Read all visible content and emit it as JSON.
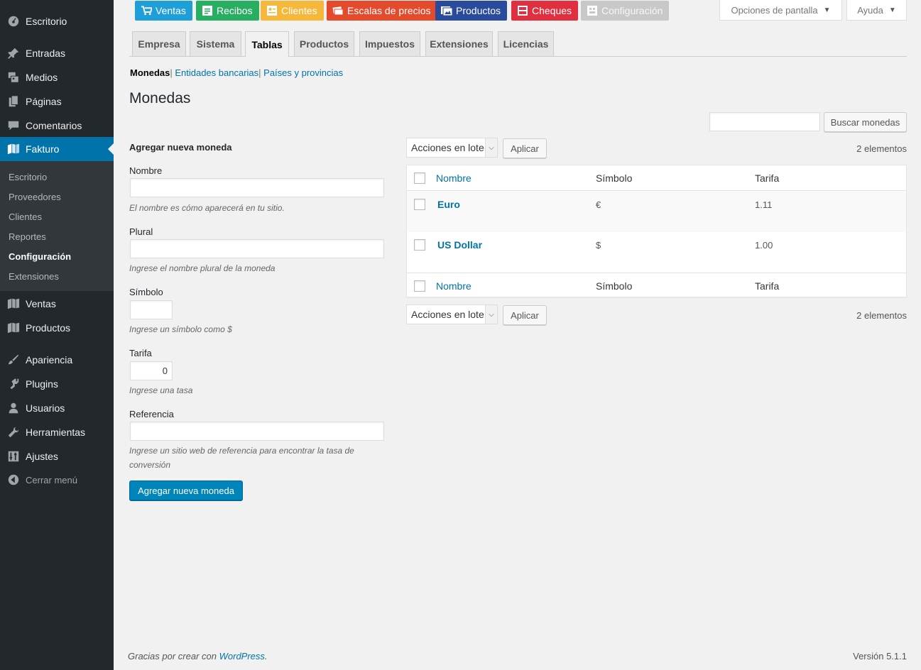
{
  "sidebar": {
    "menu": [
      {
        "label": "Escritorio",
        "icon": "dashboard-icon"
      },
      {
        "label": "Entradas",
        "icon": "pin-icon"
      },
      {
        "label": "Medios",
        "icon": "media-icon"
      },
      {
        "label": "Páginas",
        "icon": "pages-icon"
      },
      {
        "label": "Comentarios",
        "icon": "comments-icon"
      },
      {
        "label": "Fakturo",
        "icon": "fakturo-icon"
      }
    ],
    "submenu": [
      "Escritorio",
      "Proveedores",
      "Clientes",
      "Reportes",
      "Configuración",
      "Extensiones"
    ],
    "menu_after": [
      {
        "label": "Ventas",
        "icon": "fakturo-icon"
      },
      {
        "label": "Productos",
        "icon": "fakturo-icon"
      },
      {
        "label": "Apariencia",
        "icon": "brush-icon"
      },
      {
        "label": "Plugins",
        "icon": "plugin-icon"
      },
      {
        "label": "Usuarios",
        "icon": "user-icon"
      },
      {
        "label": "Herramientas",
        "icon": "wrench-icon"
      },
      {
        "label": "Ajustes",
        "icon": "settings-icon"
      }
    ],
    "collapse": "Cerrar menú"
  },
  "topbar": {
    "buttons": [
      {
        "label": "Ventas",
        "color": "#1e9fd8"
      },
      {
        "label": "Recibos",
        "color": "#27ae60"
      },
      {
        "label": "Clientes",
        "color": "#f6b83a"
      },
      {
        "label": "Escalas de precios",
        "color": "#e44b2c"
      },
      {
        "label": "Productos",
        "color": "#2a4a9c"
      },
      {
        "label": "Cheques",
        "color": "#e02f3f"
      },
      {
        "label": "Configuración",
        "color": "#c8c8c8"
      }
    ],
    "screen_options": "Opciones de pantalla",
    "help": "Ayuda"
  },
  "tabs": [
    "Empresa",
    "Sistema",
    "Tablas",
    "Productos",
    "Impuestos",
    "Extensiones",
    "Licencias"
  ],
  "active_tab": "Tablas",
  "sublinks": {
    "current": "Monedas",
    "links": [
      "Entidades bancarias",
      "Países y provincias"
    ]
  },
  "page_title": "Monedas",
  "search": {
    "button": "Buscar monedas",
    "value": ""
  },
  "form": {
    "title": "Agregar nueva moneda",
    "fields": [
      {
        "label": "Nombre",
        "value": "",
        "description": "El nombre es cómo aparecerá en tu sitio."
      },
      {
        "label": "Plural",
        "value": "",
        "description": "Ingrese el nombre plural de la moneda"
      },
      {
        "label": "Símbolo",
        "value": "",
        "description": "Ingrese un símbolo como $"
      },
      {
        "label": "Tarifa",
        "value": "0",
        "description": "Ingrese una tasa"
      },
      {
        "label": "Referencia",
        "value": "",
        "description": "Ingrese un sitio web de referencia para encontrar la tasa de conversión"
      }
    ],
    "submit": "Agregar nueva moneda"
  },
  "table": {
    "bulk_actions": "Acciones en lote",
    "apply": "Aplicar",
    "count": "2 elementos",
    "columns": [
      "Nombre",
      "Símbolo",
      "Tarifa"
    ],
    "rows": [
      {
        "name": "Euro",
        "symbol": "€",
        "rate": "1.11"
      },
      {
        "name": "US Dollar",
        "symbol": "$",
        "rate": "1.00"
      }
    ]
  },
  "footer": {
    "text": "Gracias por crear con",
    "link": "WordPress",
    "version": "Versión 5.1.1"
  }
}
